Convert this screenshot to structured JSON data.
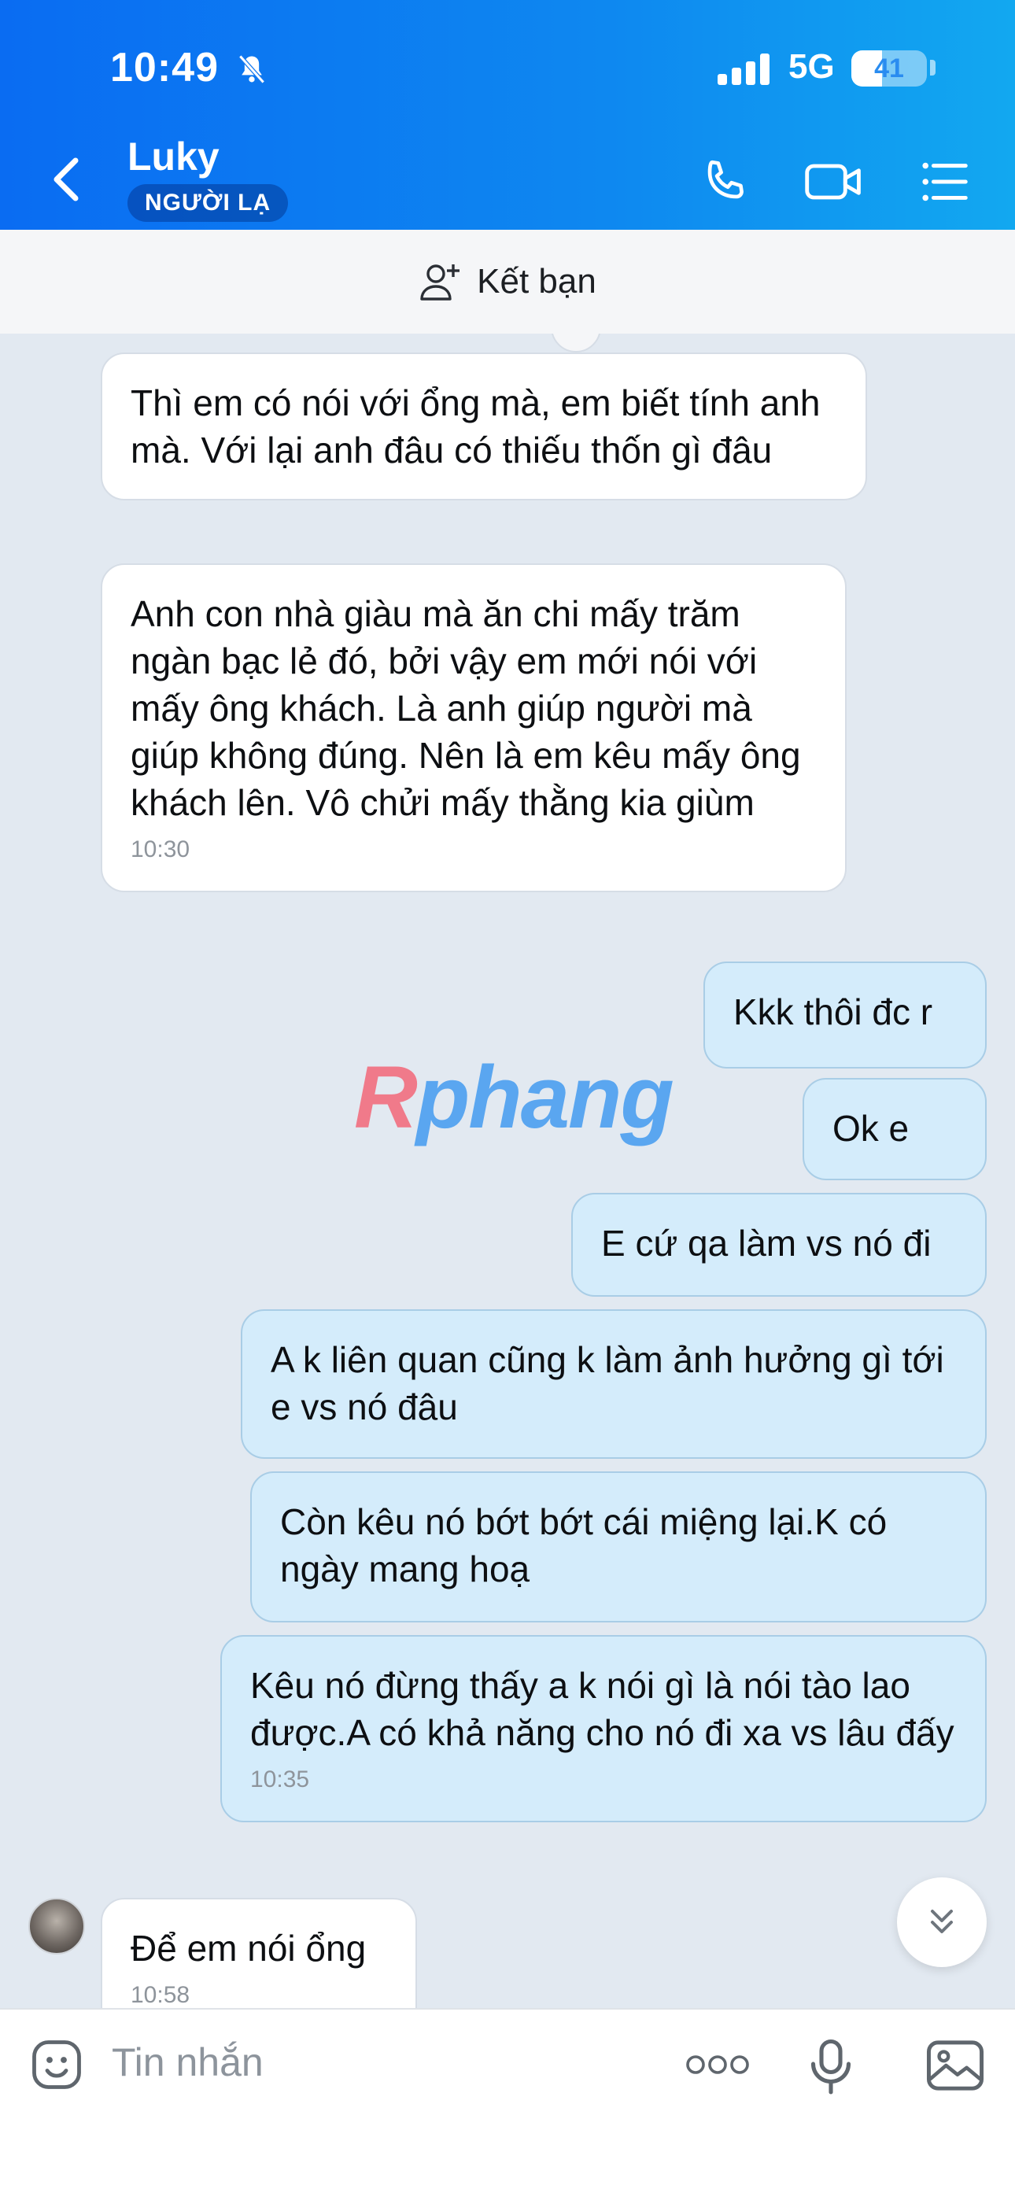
{
  "status_bar": {
    "time": "10:49",
    "network": "5G",
    "battery": "41",
    "battery_level": 0.41
  },
  "header": {
    "contact_name": "Luky",
    "tag": "NGƯỜI LẠ"
  },
  "friend_bar": {
    "label": "Kết bạn"
  },
  "messages": [
    {
      "direction": "in",
      "text": "Thì em có nói với ổng mà, em biết tính anh mà. Với lại anh đâu có thiếu thốn gì đâu",
      "time": ""
    },
    {
      "direction": "in",
      "text": "Anh con nhà giàu mà ăn chi mấy trăm ngàn bạc lẻ đó, bởi vậy em mới nói với mấy ông khách. Là anh giúp người mà giúp không đúng. Nên là em kêu mấy ông khách lên. Vô chửi mấy thằng kia giùm",
      "time": "10:30"
    },
    {
      "direction": "out",
      "text": "Kkk thôi đc r",
      "time": ""
    },
    {
      "direction": "out",
      "text": "Ok e",
      "time": ""
    },
    {
      "direction": "out",
      "text": "E cứ qa làm vs nó đi",
      "time": ""
    },
    {
      "direction": "out",
      "text": "A k liên quan cũng k làm ảnh hưởng gì tới e vs nó đâu",
      "time": ""
    },
    {
      "direction": "out",
      "text": "Còn kêu nó bớt bớt cái miệng lại.K có ngày mang hoạ",
      "time": ""
    },
    {
      "direction": "out",
      "text": "Kêu nó đừng thấy a k nói gì là nói tào lao được.A có khả năng cho nó đi xa vs lâu đấy",
      "time": "10:35"
    },
    {
      "direction": "in",
      "text": "Để em nói ổng",
      "time": "10:58"
    }
  ],
  "watermark": {
    "first": "R",
    "rest": "phang"
  },
  "input": {
    "placeholder": "Tin nhắn"
  },
  "colors": {
    "header_start": "#0a6cf2",
    "header_end": "#12a8f0",
    "outgoing_bubble": "#d4ecfb",
    "incoming_bubble": "#ffffff",
    "chat_bg": "#e2e9f1"
  }
}
